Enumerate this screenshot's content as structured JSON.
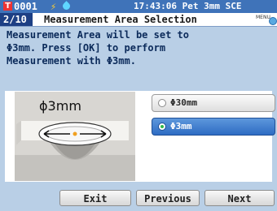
{
  "status": {
    "t_icon": "T",
    "sample": "0001",
    "bolt": "⚡",
    "clock": "17:43:06 Pet 3mm SCE",
    "drop_color": "#5fd6ff"
  },
  "header": {
    "page": "2/10",
    "title": "Measurement Area Selection",
    "menu": "MENU"
  },
  "message": "Measurement Area will be set to\nΦ3mm. Press [OK] to perform\nMeasurement with Φ3mm.",
  "illustration": {
    "size_label": "ϕ3mm"
  },
  "options": [
    {
      "label": "Φ30mm",
      "selected": false
    },
    {
      "label": "Φ3mm",
      "selected": true
    }
  ],
  "buttons": {
    "exit": "Exit",
    "previous": "Previous",
    "next": "Next"
  },
  "colors": {
    "statusbar": "#3f73b9",
    "page_badge": "#1d3f84",
    "background": "#b9cfe6",
    "selected": "#2e6cc3"
  }
}
